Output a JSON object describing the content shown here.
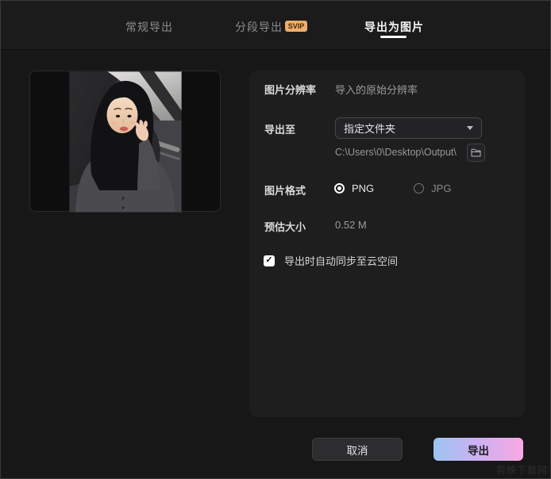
{
  "tabs": [
    {
      "label": "常规导出",
      "active": false
    },
    {
      "label": "分段导出",
      "badge": "SVIP",
      "active": false
    },
    {
      "label": "导出为图片",
      "active": true
    }
  ],
  "panel": {
    "resolution_label": "图片分辨率",
    "resolution_value": "导入的原始分辨率",
    "export_to_label": "导出至",
    "folder_select_value": "指定文件夹",
    "folder_path": "C:\\Users\\0\\Desktop\\Output\\",
    "format_label": "图片格式",
    "format_options": [
      {
        "label": "PNG",
        "selected": true
      },
      {
        "label": "JPG",
        "selected": false
      }
    ],
    "size_label": "预估大小",
    "size_value": "0.52 M",
    "sync_checkbox_label": "导出时自动同步至云空间",
    "sync_checked": true
  },
  "footer": {
    "cancel_label": "取消",
    "export_label": "导出"
  },
  "watermark": "剪映下载网",
  "colors": {
    "svip_badge": "#efae6c",
    "export_gradient_start": "#9cc4f1",
    "export_gradient_end": "#f8a9e2",
    "active_tab": "#ffffff",
    "panel_bg": "#1e1e1f"
  }
}
